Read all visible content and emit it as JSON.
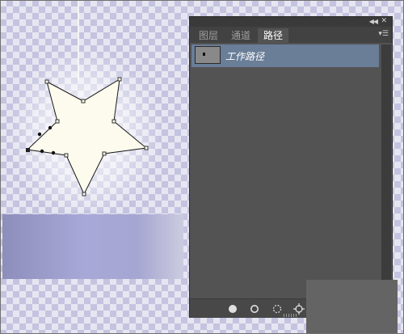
{
  "panel": {
    "tabs": [
      {
        "label": "图层"
      },
      {
        "label": "通道"
      },
      {
        "label": "路径"
      }
    ],
    "active_tab": "路径",
    "paths": [
      {
        "name": "工作路径"
      }
    ],
    "footer_icons": [
      "fill-path-icon",
      "stroke-path-icon",
      "load-selection-icon",
      "make-work-path-icon"
    ]
  },
  "colors": {
    "panel_bg": "#535353",
    "selected_row": "#6a7e98",
    "star_fill": "#fdfbed"
  }
}
